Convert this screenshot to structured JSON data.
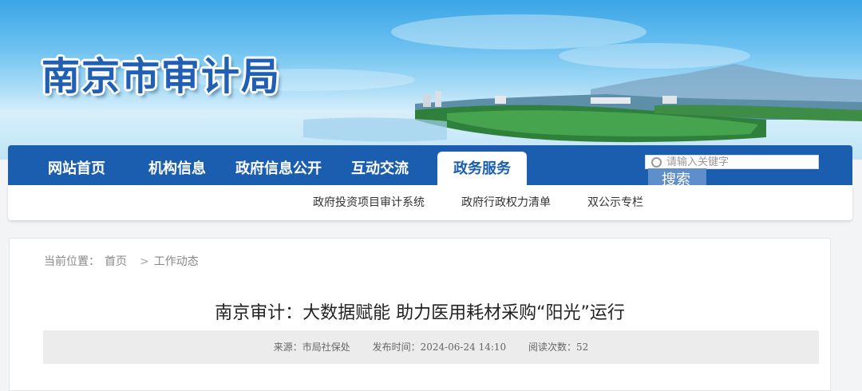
{
  "site": {
    "title": "南京市审计局"
  },
  "nav": {
    "items": [
      {
        "label": "网站首页"
      },
      {
        "label": "机构信息"
      },
      {
        "label": "政府信息公开"
      },
      {
        "label": "互动交流"
      },
      {
        "label": "政务服务",
        "active": true
      }
    ]
  },
  "search": {
    "placeholder": "请输入关键字",
    "button_label": "搜索"
  },
  "subnav": {
    "items": [
      {
        "label": "政府投资项目审计系统"
      },
      {
        "label": "政府行政权力清单"
      },
      {
        "label": "双公示专栏"
      }
    ]
  },
  "breadcrumb": {
    "prefix": "当前位置：",
    "items": [
      "首页",
      "工作动态"
    ],
    "separator": ">"
  },
  "article": {
    "title": "南京审计：大数据赋能 助力医用耗材采购“阳光”运行",
    "meta": {
      "source": "来源：市局社保处",
      "published": "发布时间：2024-06-24 14:10",
      "views": "阅读次数：52"
    }
  },
  "colors": {
    "nav_blue": "#1b5eb0",
    "title_blue": "#1f5fb4",
    "search_button": "#5f8fca"
  }
}
